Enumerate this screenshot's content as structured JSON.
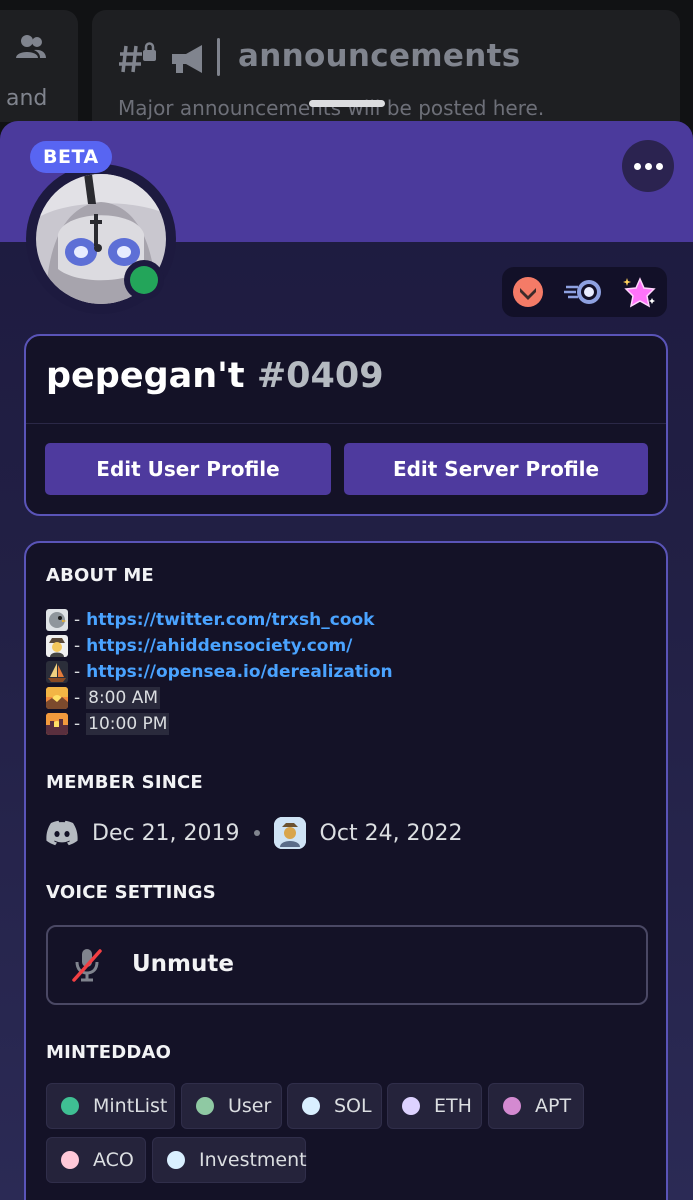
{
  "background": {
    "left_text": "and",
    "channel_name": "announcements",
    "channel_topic": "Major announcements will be posted here."
  },
  "profile": {
    "beta_label": "BETA",
    "username": "pepegan't",
    "discriminator": "#0409",
    "status": "online",
    "status_color": "#23a55a",
    "badges": [
      "hypesquad-brilliance-icon",
      "nitro-boost-icon",
      "nitro-star-icon"
    ],
    "edit_user_label": "Edit User Profile",
    "edit_server_label": "Edit Server Profile"
  },
  "about": {
    "title": "ABOUT ME",
    "lines": [
      {
        "emoji": "bird-emoji",
        "sep": "-",
        "text": "https://twitter.com/trxsh_cook"
      },
      {
        "emoji": "detective-emoji",
        "sep": "-",
        "text": "https://ahiddensociety.com/"
      },
      {
        "emoji": "sailboat-emoji",
        "sep": "-",
        "text": "https://opensea.io/derealization"
      },
      {
        "emoji": "sunrise-emoji",
        "sep": "-",
        "text": "8:00 AM"
      },
      {
        "emoji": "city-sunset-emoji",
        "sep": "-",
        "text": "10:00 PM"
      }
    ]
  },
  "member_since": {
    "title": "MEMBER SINCE",
    "discord_date": "Dec 21, 2019",
    "server_date": "Oct 24, 2022"
  },
  "voice": {
    "title": "VOICE SETTINGS",
    "unmute_label": "Unmute"
  },
  "roles": {
    "title": "MINTEDDAO",
    "items": [
      {
        "name": "MintList",
        "color": "#3fbf93"
      },
      {
        "name": "User",
        "color": "#8fc9a3"
      },
      {
        "name": "SOL",
        "color": "#d9efff"
      },
      {
        "name": "ETH",
        "color": "#ddd2ff"
      },
      {
        "name": "APT",
        "color": "#d48ad1"
      },
      {
        "name": "ACO",
        "color": "#ffc9d9"
      },
      {
        "name": "Investment",
        "color": "#d9efff"
      }
    ]
  },
  "colors": {
    "banner": "#4b3a9c",
    "accent": "#5865f2",
    "link": "#4aa3ff",
    "button": "#4e3a9e"
  }
}
